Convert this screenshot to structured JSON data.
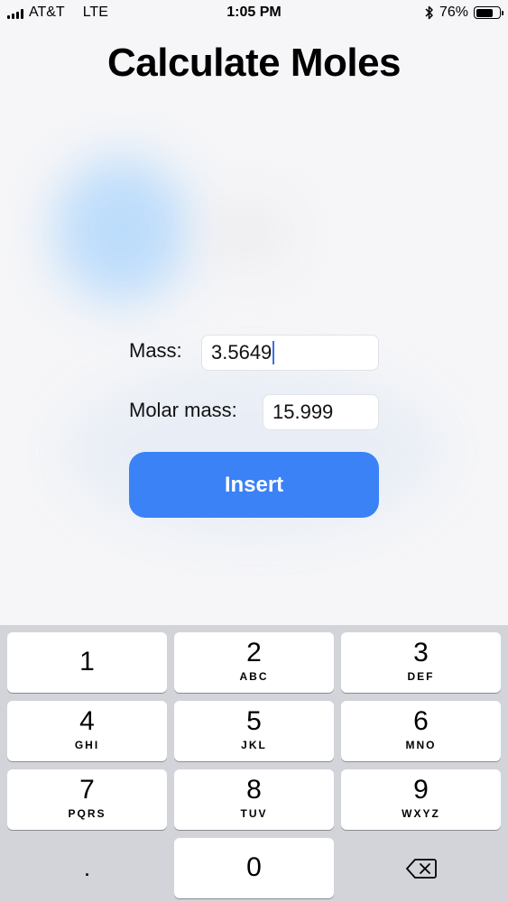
{
  "status_bar": {
    "carrier": "AT&T",
    "network": "LTE",
    "time": "1:05 PM",
    "bluetooth_icon": "bluetooth-icon",
    "battery_percent": "76%",
    "battery_level": 0.76
  },
  "title": "Calculate Moles",
  "form": {
    "mass_label": "Mass:",
    "mass_value": "3.5649",
    "molar_mass_label": "Molar mass:",
    "molar_mass_value": "15.999",
    "insert_label": "Insert"
  },
  "keyboard": {
    "keys": [
      {
        "num": "1",
        "letters": ""
      },
      {
        "num": "2",
        "letters": "ABC"
      },
      {
        "num": "3",
        "letters": "DEF"
      },
      {
        "num": "4",
        "letters": "GHI"
      },
      {
        "num": "5",
        "letters": "JKL"
      },
      {
        "num": "6",
        "letters": "MNO"
      },
      {
        "num": "7",
        "letters": "PQRS"
      },
      {
        "num": "8",
        "letters": "TUV"
      },
      {
        "num": "9",
        "letters": "WXYZ"
      }
    ],
    "decimal": ".",
    "zero": "0",
    "delete_icon": "backspace-icon"
  },
  "colors": {
    "accent": "#3a82f6",
    "keyboard_bg": "#d2d4da"
  }
}
